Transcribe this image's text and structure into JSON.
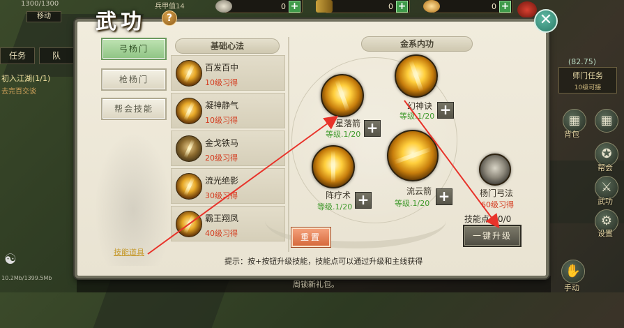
{
  "colors": {
    "accent_green": "#3f9a2c",
    "requirement_red": "#d43a1d",
    "active_tab": "#8fc484",
    "annotation_arrow": "#e8332a"
  },
  "background": {
    "player_hp": "1300/1300",
    "left_button": "移动",
    "top_info": "兵甲值14",
    "resources": [
      {
        "icon": "coin-icon",
        "value": "0"
      },
      {
        "icon": "scroll-icon",
        "value": "0"
      },
      {
        "icon": "ingot-icon",
        "value": "0"
      }
    ],
    "left_tabs": [
      "任务",
      "队"
    ],
    "quest_title": "初入江湖(1/1)",
    "quest_sub": "去完百交谈",
    "coordinate": "(82.75)",
    "faction_task": {
      "title": "师门任务",
      "sub": "10级可接"
    },
    "right_buttons": [
      {
        "label": "背包",
        "icon": "grid-icon"
      },
      {
        "label": "帮会",
        "icon": "faction-icon"
      },
      {
        "label": "武功",
        "icon": "martial-icon"
      },
      {
        "label": "设置",
        "icon": "gear-icon"
      },
      {
        "label": "手动",
        "icon": "hand-icon"
      }
    ],
    "chat_text": "周锁新礼包。",
    "net_stat": "10.2Mb/1399.5Mb"
  },
  "panel": {
    "title": "武功",
    "help": "?",
    "close": "✕",
    "tabs": [
      {
        "label": "弓杨门",
        "active": true
      },
      {
        "label": "枪杨门",
        "active": false
      },
      {
        "label": "帮会技能",
        "active": false
      }
    ],
    "skill_link": "技能道具",
    "basic_header": "基础心法",
    "basic_skills": [
      {
        "name": "百发百中",
        "req": "10级习得"
      },
      {
        "name": "凝神静气",
        "req": "10级习得"
      },
      {
        "name": "金戈铁马",
        "req": "20级习得"
      },
      {
        "name": "流光绝影",
        "req": "30级习得"
      },
      {
        "name": "霸王翔凤",
        "req": "40级习得"
      }
    ],
    "metal_header": "金系内功",
    "kungfu": {
      "huanshen": {
        "name": "幻神诀",
        "level": "等级.1/20"
      },
      "xingluo": {
        "name": "星落箭",
        "level": "等级.1/20"
      },
      "zhenliao": {
        "name": "阵疗术",
        "level": "等级.1/20"
      },
      "liuyun": {
        "name": "流云箭",
        "level": "等级.1/20"
      },
      "yangmen": {
        "name": "杨门弓法",
        "req": "60级习得"
      }
    },
    "plus": "+",
    "skill_points": "技能点：0/0",
    "upgrade_button": "一键升级",
    "reset_button": "重置",
    "hint": "提示：按+按钮升级技能，技能点可以通过升级和主线获得"
  }
}
